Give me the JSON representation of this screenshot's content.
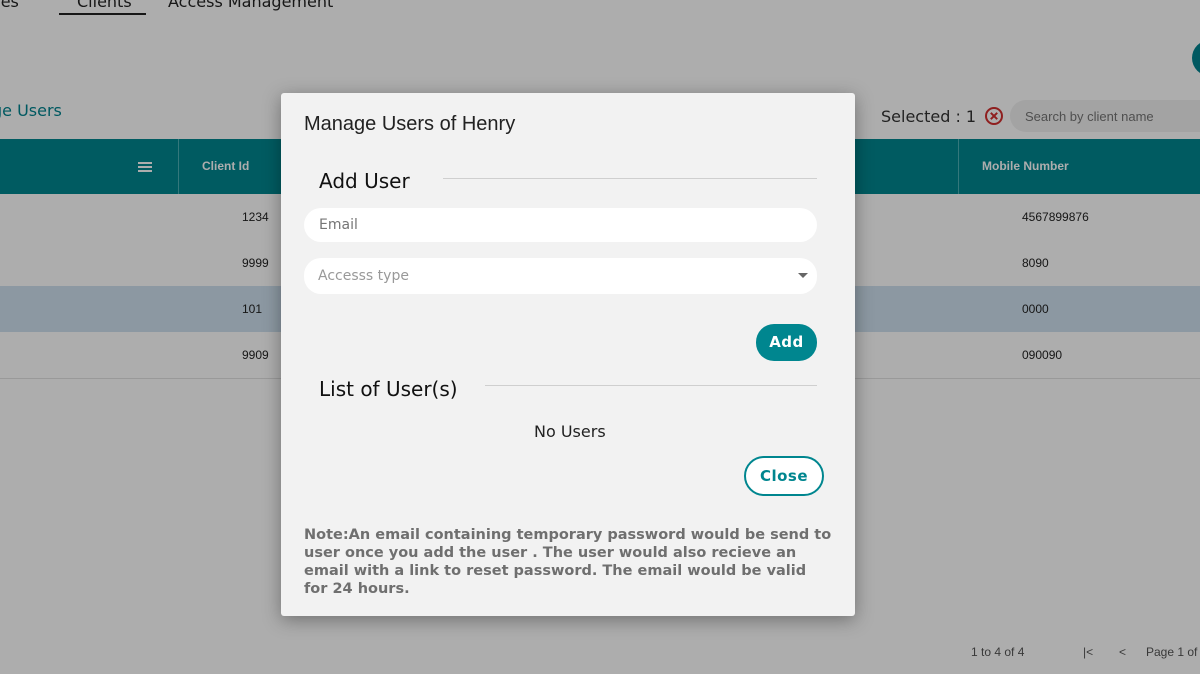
{
  "tabs": {
    "devices": "vices",
    "clients": "Clients",
    "access": "Access Management"
  },
  "page": {
    "manage_users": "ge Users"
  },
  "toolbar": {
    "selected": "Selected : 1",
    "search_placeholder": "Search by client name"
  },
  "grid": {
    "headers": {
      "client_id": "Client Id",
      "mobile_number": "Mobile Number"
    },
    "rows": [
      {
        "client_id": "1234",
        "mobile": "4567899876"
      },
      {
        "client_id": "9999",
        "mobile": "8090"
      },
      {
        "client_id": "101",
        "mobile": "0000"
      },
      {
        "client_id": "9909",
        "mobile": "090090"
      }
    ]
  },
  "pagination": {
    "range": "1 to 4 of 4",
    "page": "Page 1 of"
  },
  "modal": {
    "title": "Manage Users of Henry",
    "add_user_heading": "Add User",
    "email_placeholder": "Email",
    "access_placeholder": "Accesss type",
    "add_label": "Add",
    "list_heading": "List of User(s)",
    "no_users": "No Users",
    "close_label": "Close",
    "note": "Note:An email containing temporary password would be send to user once you add the user . The user would also recieve an email with a link to reset password. The email would be valid for 24 hours."
  },
  "colors": {
    "accent": "#00868f",
    "selected_row": "#cfe0ef",
    "clear_icon": "#d32f2f"
  }
}
